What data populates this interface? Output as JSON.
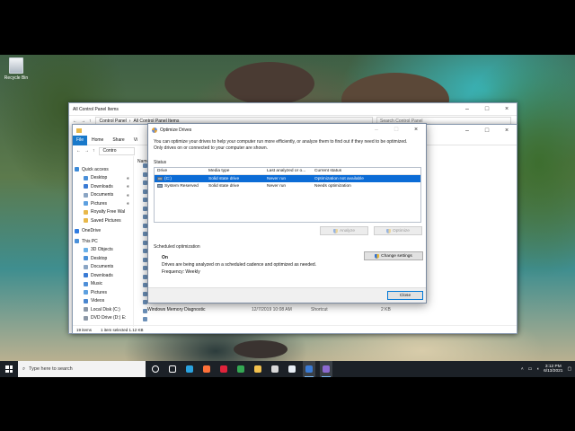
{
  "desktop": {
    "recycle_bin_label": "Recycle Bin"
  },
  "control_panel_window": {
    "title": "All Control Panel Items",
    "breadcrumb": [
      "Control Panel",
      "All Control Panel Items"
    ],
    "search_placeholder": "Search Control Panel"
  },
  "explorer_window": {
    "ribbon_tabs": [
      "File",
      "Home",
      "Share",
      "Vi"
    ],
    "address_fragment": "Contro",
    "column_name_fragment": "Name",
    "nav_items": [
      {
        "label": "Quick access",
        "icon": "star-icon",
        "color": "#3c8ad8",
        "pinned": false
      },
      {
        "label": "Desktop",
        "icon": "desktop-icon",
        "color": "#4a90d9",
        "pinned": true
      },
      {
        "label": "Downloads",
        "icon": "download-icon",
        "color": "#3a7bd5",
        "pinned": true
      },
      {
        "label": "Documents",
        "icon": "document-icon",
        "color": "#8aa5c4",
        "pinned": true
      },
      {
        "label": "Pictures",
        "icon": "pictures-icon",
        "color": "#5da0e0",
        "pinned": true
      },
      {
        "label": "Royalty Free Wal",
        "icon": "folder-icon",
        "color": "#e8b84a",
        "pinned": false
      },
      {
        "label": "Saved Pictures",
        "icon": "folder-icon",
        "color": "#e8b84a",
        "pinned": false
      },
      {
        "label": "OneDrive",
        "icon": "cloud-icon",
        "color": "#2f7be0",
        "pinned": false
      },
      {
        "label": "This PC",
        "icon": "computer-icon",
        "color": "#4a90d9",
        "pinned": false
      },
      {
        "label": "3D Objects",
        "icon": "cube-icon",
        "color": "#6ab0e8",
        "pinned": false
      },
      {
        "label": "Desktop",
        "icon": "desktop-icon",
        "color": "#4a90d9",
        "pinned": false
      },
      {
        "label": "Documents",
        "icon": "document-icon",
        "color": "#8aa5c4",
        "pinned": false
      },
      {
        "label": "Downloads",
        "icon": "download-icon",
        "color": "#3a7bd5",
        "pinned": false
      },
      {
        "label": "Music",
        "icon": "music-icon",
        "color": "#4f8fd8",
        "pinned": false
      },
      {
        "label": "Pictures",
        "icon": "pictures-icon",
        "color": "#5da0e0",
        "pinned": false
      },
      {
        "label": "Videos",
        "icon": "video-icon",
        "color": "#4a86cf",
        "pinned": false
      },
      {
        "label": "Local Disk (C:)",
        "icon": "disk-icon",
        "color": "#8b97a6",
        "pinned": false
      },
      {
        "label": "DVD Drive (D:) E:",
        "icon": "dvd-icon",
        "color": "#8b97a6",
        "pinned": false
      }
    ],
    "file_row": {
      "name": "Windows Memory Diagnostic",
      "date": "12/7/2019 10:08 AM",
      "type": "Shortcut",
      "size": "2 KB"
    },
    "status": {
      "items": "19 items",
      "selected": "1 item selected  1.12 KB"
    }
  },
  "optimize_drives": {
    "title": "Optimize Drives",
    "intro": "You can optimize your drives to help your computer run more efficiently, or analyze them to find out if they need to be optimized. Only drives on or connected to your computer are shown.",
    "status_label": "Status",
    "columns": [
      "Drive",
      "Media type",
      "Last analyzed or o...",
      "Current status"
    ],
    "drives": [
      {
        "drive": "(C:)",
        "media": "Solid state drive",
        "last": "Never run",
        "status": "Optimization not available",
        "selected": true
      },
      {
        "drive": "System Reserved",
        "media": "Solid state drive",
        "last": "Never run",
        "status": "Needs optimization",
        "selected": false
      }
    ],
    "analyze_label": "Analyze",
    "optimize_label": "Optimize",
    "scheduled_label": "Scheduled optimization",
    "schedule_state": "On",
    "schedule_desc": "Drives are being analyzed on a scheduled cadence and optimized as needed.",
    "frequency": "Frequency: Weekly",
    "change_settings_label": "Change settings",
    "close_label": "Close"
  },
  "taskbar": {
    "search_placeholder": "Type here to search",
    "apps": [
      {
        "name": "cortana-icon",
        "color": "#ffffff",
        "active": false
      },
      {
        "name": "task-view-icon",
        "color": "#ffffff",
        "active": false
      },
      {
        "name": "edge-icon",
        "color": "#2aa3e0",
        "active": false
      },
      {
        "name": "firefox-icon",
        "color": "#ff7139",
        "active": false
      },
      {
        "name": "opera-icon",
        "color": "#e0233b",
        "active": false
      },
      {
        "name": "chrome-icon",
        "color": "#34a853",
        "active": false
      },
      {
        "name": "file-explorer-icon",
        "color": "#f2c14e",
        "active": false
      },
      {
        "name": "store-icon",
        "color": "#d8d8d8",
        "active": false
      },
      {
        "name": "mail-icon",
        "color": "#e8eef5",
        "active": false
      },
      {
        "name": "control-panel-icon",
        "color": "#3a7bd5",
        "active": true
      },
      {
        "name": "defrag-icon",
        "color": "#8c6ad0",
        "active": true
      }
    ],
    "time": "3:12 PM",
    "date": "6/13/2021"
  },
  "colors": {
    "accent": "#0c6cd6",
    "taskbar": "#1c2127",
    "file_tab": "#1979ca"
  }
}
